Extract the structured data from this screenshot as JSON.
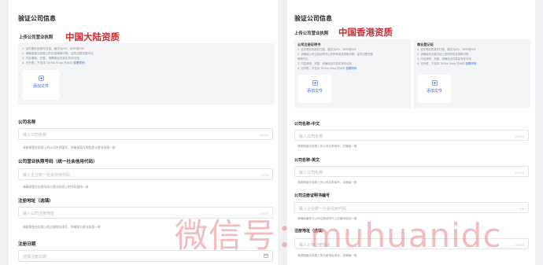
{
  "left": {
    "title": "验证公司信息",
    "upload_label": "上传公司营业执照",
    "region_label": "中国大陆资质",
    "rules": [
      "1. 证件需彩色原件扫描，格式为JPG、BMP或PDF",
      "2. 请确保营业执照上的字迹清晰可辨，证件边框完整可见",
      "3. 内容清晰、完整，请确保证件真实有效可用",
      "4. 无外框，不支持 TikTok Shop 的水印"
    ],
    "rules_link": "查看样例",
    "upload_button": "添加文件",
    "fields": [
      {
        "label": "公司名称",
        "placeholder": "输入公司名称",
        "counter": "0/100",
        "hint": "请按照营业执照上的公司名称填写，并确保填写的信息与营业执照一致"
      },
      {
        "label": "公司营业执照号码（统一社会信用代码）",
        "placeholder": "输入企业统一社会信用代码",
        "counter": "0/18",
        "hint": "请确保营业执照号码与营业执照上的号码保持一致"
      },
      {
        "label": "注册地址（选填）",
        "placeholder": "输入公司注册地址",
        "counter": "0/200",
        "hint": "请按照营业执照上的注册地址填写，并确保与营业执照一致"
      },
      {
        "label": "注册日期",
        "placeholder": "选择注册日期",
        "counter": "",
        "hint": ""
      }
    ]
  },
  "right": {
    "title": "验证公司信息",
    "upload_label": "上传公司营业执照",
    "region_label": "中国香港资质",
    "cards": [
      {
        "title": "公司注册证明书",
        "rules": [
          "1. 证件需彩色原件扫描，格式为JPG、BMP或PDF",
          "2. 请确保公司注册证明书上的所有信息清晰可辨，证件边框完整",
          "清晰可见",
          "3. 内容清晰、完整，请确保证件真实有效可用",
          "4. 无外框，不支持 TikTok Shop 的水印"
        ],
        "link": "查看样例",
        "button": "添加文件"
      },
      {
        "title": "商业登记证",
        "rules": [
          "1. 证件需彩色原件扫描，格式为JPG、BMP或PDF",
          "2. 请确保商业登记证上的所有信息清晰可辨",
          "3. 内容清晰、完整，请确保证件真实有效可用",
          "4. 无外框，不支持 TikTok Shop 的水印"
        ],
        "link": "查看样例",
        "button": "添加文件"
      }
    ],
    "fields": [
      {
        "label": "公司名称-中文",
        "placeholder": "输入公司名称",
        "counter": "0/100",
        "hint": "请按照营业执照上的公司名称填写，并确保一致"
      },
      {
        "label": "公司名称-英文",
        "placeholder": "输入公司名称",
        "counter": "0/100",
        "hint": "请按照营业执照上的公司名称填写，并确保一致"
      },
      {
        "label": "公司注册证明书编号",
        "placeholder": "输入企业统一社会信用代码",
        "counter": "0/8",
        "hint": "请确保编号与公司注册证明书上的编号保持一致"
      },
      {
        "label": "注册地址（选填）",
        "placeholder": "输入公司注册地址",
        "counter": "0/200",
        "hint": "请按照营业执照上的注册地址填写，并确保一致"
      }
    ]
  },
  "watermark": "微信号：muhuanidc"
}
